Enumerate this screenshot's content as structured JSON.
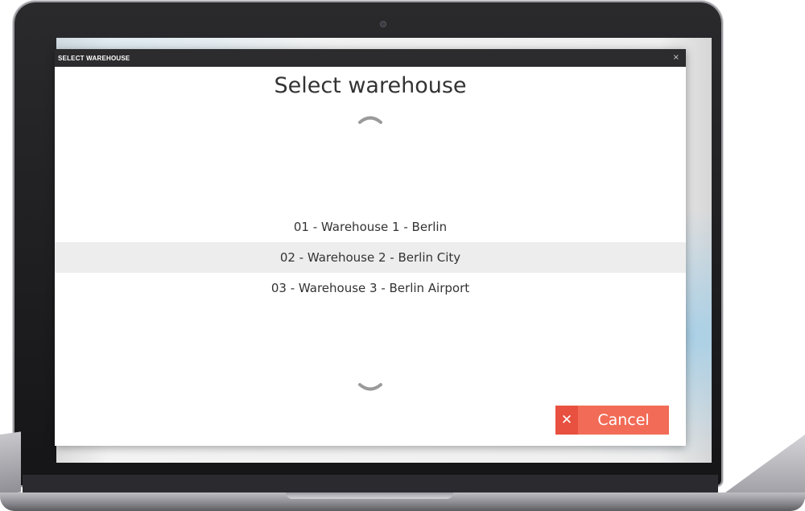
{
  "window": {
    "title": "SELECT WAREHOUSE",
    "close_icon": "close-icon"
  },
  "dialog": {
    "heading": "Select warehouse",
    "scroll_up_icon": "chevron-up-icon",
    "scroll_down_icon": "chevron-down-icon",
    "selected_index": 1,
    "warehouses": [
      {
        "label": "01 - Warehouse 1 - Berlin"
      },
      {
        "label": "02 - Warehouse 2 - Berlin City"
      },
      {
        "label": "03 - Warehouse 3 - Berlin Airport"
      }
    ]
  },
  "actions": {
    "cancel_label": "Cancel",
    "cancel_icon": "close-icon"
  },
  "colors": {
    "titlebar": "#2c2c2e",
    "cancel_button": "#f26b57",
    "cancel_icon_box": "#e8503f",
    "selected_row": "#ededed"
  }
}
